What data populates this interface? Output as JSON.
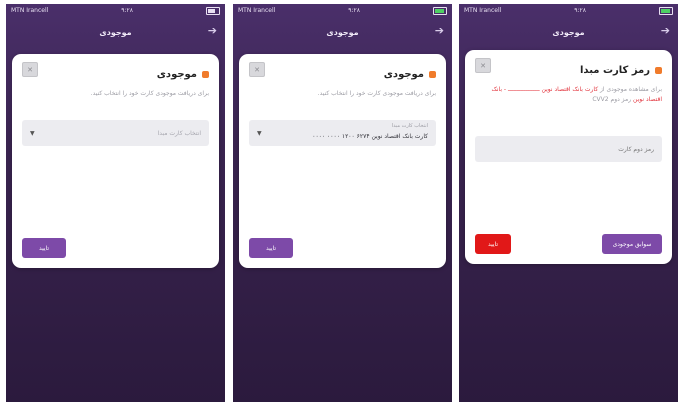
{
  "screens": [
    {
      "status": {
        "carrier": "MTN Irancell",
        "time": "۹:۲۸"
      },
      "topbar_title": "موجودی",
      "card": {
        "title": "موجودی",
        "description": "برای دریافت موجودی کارت خود را انتخاب کنید.",
        "select_placeholder": "انتخاب کارت مبدا",
        "button": "تایید"
      }
    },
    {
      "status": {
        "carrier": "MTN Irancell",
        "time": "۹:۲۸"
      },
      "topbar_title": "موجودی",
      "card": {
        "title": "موجودی",
        "description": "برای دریافت موجودی کارت خود را انتخاب کنید.",
        "select_label": "انتخاب کارت مبدا",
        "select_value": "کارت بانک اقتصاد نوین ۶۲۷۴ ۱۲۰۰ ۰۰۰۰ ۰۰۰۰",
        "button": "تایید"
      }
    },
    {
      "status": {
        "carrier": "MTN Irancell",
        "time": "۹:۲۸"
      },
      "topbar_title": "موجودی",
      "card": {
        "title": "رمز کارت مبدا",
        "description_prefix": "برای مشاهده موجودی از",
        "description_red": "کارت بانک اقتصاد نوین ــــــــــــــــــ - بانک اقتصاد نوین",
        "description_suffix": "رمز دوم CVV2",
        "input_placeholder": "رمز دوم کارت",
        "button_secondary": "سوابق موجودی",
        "button_confirm": "تایید"
      }
    }
  ],
  "icons": {
    "back": "back-arrow-icon",
    "close": "close-icon",
    "title_marker": "square-bullet-icon"
  },
  "colors": {
    "accent": "#7d4aa8",
    "danger": "#e11818",
    "marker": "#f07b2b",
    "background_top": "#4a2f6a"
  }
}
